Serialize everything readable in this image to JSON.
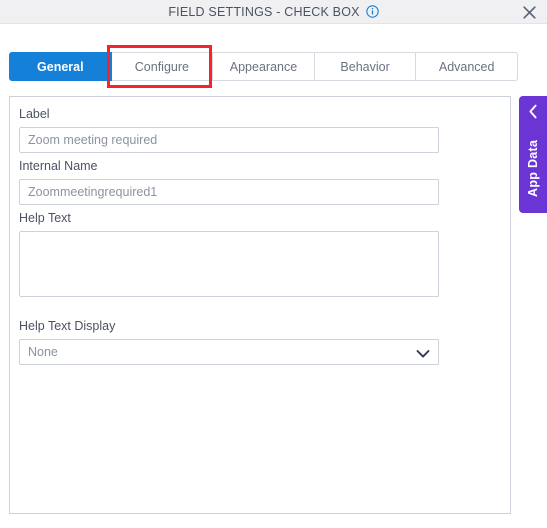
{
  "titlebar": {
    "title": "FIELD SETTINGS - CHECK BOX",
    "info_icon": "info-circle-icon",
    "close_icon": "close-icon"
  },
  "tabs": [
    {
      "label": "General",
      "active": true,
      "highlighted": false
    },
    {
      "label": "Configure",
      "active": false,
      "highlighted": true
    },
    {
      "label": "Appearance",
      "active": false,
      "highlighted": false
    },
    {
      "label": "Behavior",
      "active": false,
      "highlighted": false
    },
    {
      "label": "Advanced",
      "active": false,
      "highlighted": false
    }
  ],
  "form": {
    "label_field": {
      "label": "Label",
      "value": "Zoom meeting required",
      "placeholder": "Zoom meeting required"
    },
    "internal_name_field": {
      "label": "Internal Name",
      "value": "Zoommeetingrequired1",
      "placeholder": "Zoommeetingrequired1"
    },
    "help_text_field": {
      "label": "Help Text",
      "value": "",
      "placeholder": ""
    },
    "help_text_display_field": {
      "label": "Help Text Display",
      "value": "None",
      "options": [
        "None"
      ],
      "chevron_icon": "chevron-down-icon"
    }
  },
  "side_panel": {
    "label": "App Data",
    "collapse_icon": "chevron-left-icon"
  },
  "colors": {
    "accent_blue": "#1580d8",
    "annotation_red": "#f5232b",
    "app_data_purple": "#6b35d6",
    "titlebar_bg": "#f0f0f2",
    "text_muted": "#8b93a3",
    "label_text": "#4a5264",
    "border": "#cdd2db"
  }
}
